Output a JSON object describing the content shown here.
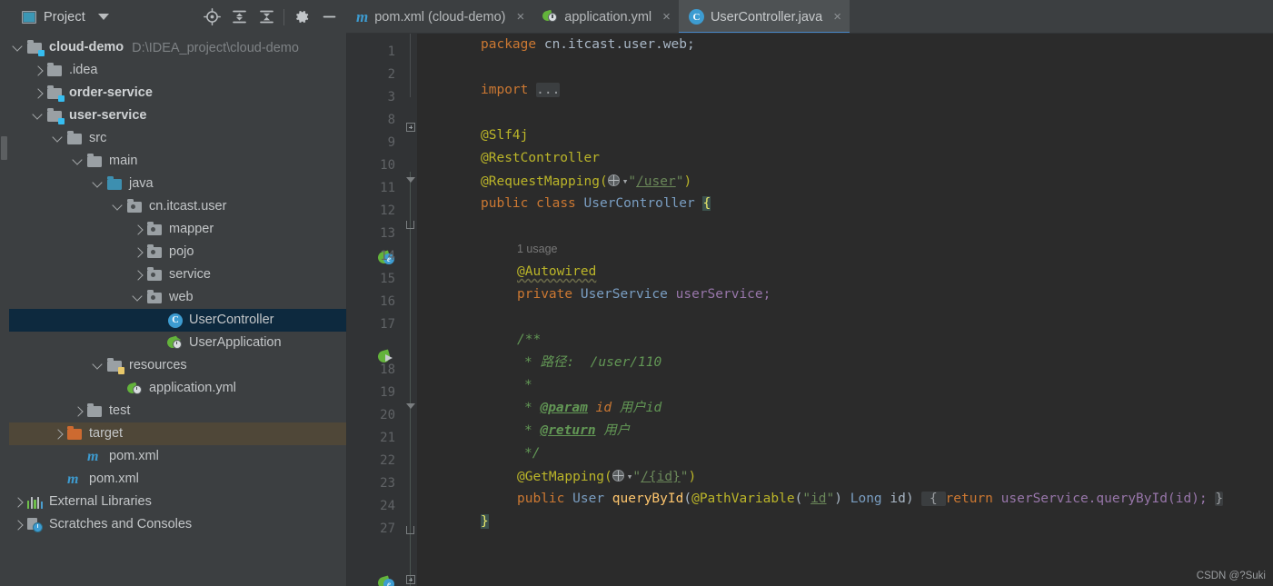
{
  "toolwindow": {
    "title": "Project",
    "icons": [
      "project-icon",
      "chevron-down-icon",
      "locate-icon",
      "expand-all-icon",
      "collapse-all-icon",
      "settings-gear-icon",
      "hide-icon"
    ]
  },
  "tabs": [
    {
      "label": "pom.xml (cloud-demo)",
      "icon": "maven-icon",
      "active": false,
      "close": "×"
    },
    {
      "label": "application.yml",
      "icon": "spring-yaml-icon",
      "active": false,
      "close": "×"
    },
    {
      "label": "UserController.java",
      "icon": "java-class-icon",
      "active": true,
      "close": "×"
    }
  ],
  "tree": [
    {
      "label": "cloud-demo",
      "path": "D:\\IDEA_project\\cloud-demo",
      "indent": 0,
      "arrow": "down",
      "icon": "module-folder",
      "bold": true,
      "state": "none"
    },
    {
      "label": ".idea",
      "path": "",
      "indent": 1,
      "arrow": "right",
      "icon": "folder",
      "bold": false,
      "state": "none"
    },
    {
      "label": "order-service",
      "path": "",
      "indent": 1,
      "arrow": "right",
      "icon": "module-folder",
      "bold": true,
      "state": "none"
    },
    {
      "label": "user-service",
      "path": "",
      "indent": 1,
      "arrow": "down",
      "icon": "module-folder",
      "bold": true,
      "state": "none"
    },
    {
      "label": "src",
      "path": "",
      "indent": 2,
      "arrow": "down",
      "icon": "folder",
      "bold": false,
      "state": "none"
    },
    {
      "label": "main",
      "path": "",
      "indent": 3,
      "arrow": "down",
      "icon": "folder",
      "bold": false,
      "state": "none"
    },
    {
      "label": "java",
      "path": "",
      "indent": 4,
      "arrow": "down",
      "icon": "source-folder",
      "bold": false,
      "state": "none"
    },
    {
      "label": "cn.itcast.user",
      "path": "",
      "indent": 5,
      "arrow": "down",
      "icon": "package",
      "bold": false,
      "state": "none"
    },
    {
      "label": "mapper",
      "path": "",
      "indent": 6,
      "arrow": "right",
      "icon": "package",
      "bold": false,
      "state": "none"
    },
    {
      "label": "pojo",
      "path": "",
      "indent": 6,
      "arrow": "right",
      "icon": "package",
      "bold": false,
      "state": "none"
    },
    {
      "label": "service",
      "path": "",
      "indent": 6,
      "arrow": "right",
      "icon": "package",
      "bold": false,
      "state": "none"
    },
    {
      "label": "web",
      "path": "",
      "indent": 6,
      "arrow": "down",
      "icon": "package",
      "bold": false,
      "state": "none"
    },
    {
      "label": "UserController",
      "path": "",
      "indent": 7,
      "arrow": "none",
      "icon": "java-class",
      "bold": false,
      "state": "selected"
    },
    {
      "label": "UserApplication",
      "path": "",
      "indent": 7,
      "arrow": "none",
      "icon": "spring-boot",
      "bold": false,
      "state": "none"
    },
    {
      "label": "resources",
      "path": "",
      "indent": 4,
      "arrow": "down",
      "icon": "resource-folder",
      "bold": false,
      "state": "none"
    },
    {
      "label": "application.yml",
      "path": "",
      "indent": 5,
      "arrow": "none",
      "icon": "spring-yaml",
      "bold": false,
      "state": "none"
    },
    {
      "label": "test",
      "path": "",
      "indent": 3,
      "arrow": "right",
      "icon": "folder",
      "bold": false,
      "state": "none"
    },
    {
      "label": "target",
      "path": "",
      "indent": 2,
      "arrow": "right",
      "icon": "excluded-folder",
      "bold": false,
      "state": "excluded"
    },
    {
      "label": "pom.xml",
      "path": "",
      "indent": 3,
      "arrow": "none",
      "icon": "maven-file",
      "bold": false,
      "state": "none"
    },
    {
      "label": "pom.xml",
      "path": "",
      "indent": 2,
      "arrow": "none",
      "icon": "maven-file",
      "bold": false,
      "state": "none"
    },
    {
      "label": "External Libraries",
      "path": "",
      "indent": 0,
      "arrow": "right",
      "icon": "libraries",
      "bold": false,
      "state": "none"
    },
    {
      "label": "Scratches and Consoles",
      "path": "",
      "indent": 0,
      "arrow": "right",
      "icon": "scratches",
      "bold": false,
      "state": "none"
    }
  ],
  "editor": {
    "line_numbers": [
      "1",
      "2",
      "3",
      "8",
      "9",
      "10",
      "11",
      "12",
      "13",
      "14",
      "15",
      "16",
      "17",
      "18",
      "19",
      "20",
      "21",
      "22",
      "23",
      "24",
      "27"
    ],
    "usage_hint": "1 usage",
    "code": {
      "l1_kw": "package",
      "l1_pkg": "cn.itcast.user.web;",
      "l3_kw": "import",
      "l3_fold": "...",
      "l9": "@Slf4j",
      "l10": "@RestController",
      "l11_ann": "@RequestMapping(",
      "l11_str": "\"/user\"",
      "l11_url": "/user",
      "l11_end": ")",
      "l12_kw1": "public",
      "l12_kw2": "class",
      "l12_name": "UserController",
      "l12_brace": "{",
      "l14": "@Autowired",
      "l15_kw": "private",
      "l15_type": "UserService",
      "l15_field": "userService;",
      "l17": "/**",
      "l18": "* 路径:  /user/110",
      "l19": "*",
      "l20_star": "* ",
      "l20_tag": "@param",
      "l20_name": " id ",
      "l20_desc": "用户id",
      "l21_star": "* ",
      "l21_tag": "@return",
      "l21_desc": " 用户",
      "l22": "*/",
      "l23_ann": "@GetMapping(",
      "l23_str": "\"/{id}\"",
      "l23_url": "/{id}",
      "l23_end": ")",
      "l24_kw": "public",
      "l24_type": "User",
      "l24_mth": "queryById",
      "l24_ann": "@PathVariable",
      "l24_str": "\"id\"",
      "l24_param": "Long id)",
      "l24_open": "{",
      "l24_ret_kw": "return",
      "l24_ret_expr": "userService.queryById(id);",
      "l24_close": "}",
      "l27": "}"
    },
    "watermark": "CSDN @?Suki"
  },
  "colors": {
    "background": "#3c3f41",
    "editor_background": "#2b2b2b",
    "gutter_background": "#313335",
    "selection": "#0d293e",
    "excluded_row": "#4f4738",
    "tab_active": "#4e5254",
    "tab_underline": "#4a88c7",
    "keyword": "#cc7832",
    "annotation": "#bbb529",
    "string": "#6a8759",
    "comment": "#629755",
    "field": "#9876aa",
    "method": "#ffc66d",
    "classname": "#7a9ec2"
  }
}
